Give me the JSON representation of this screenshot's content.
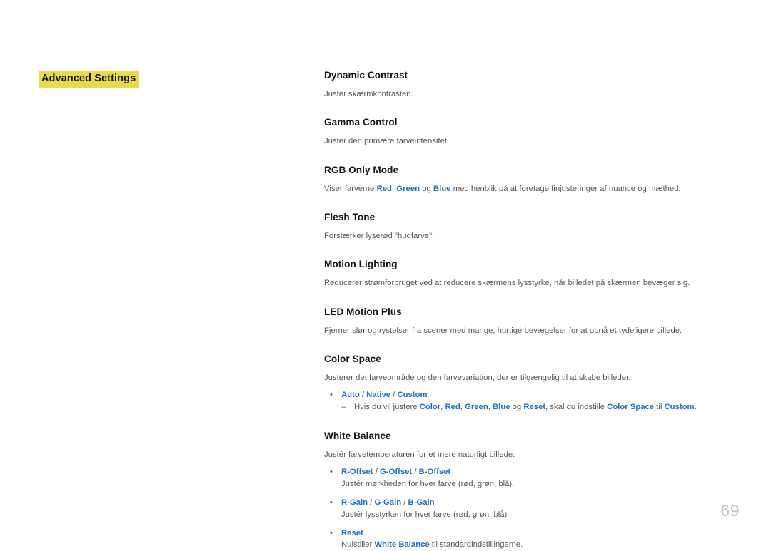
{
  "page": {
    "number": "69",
    "background": "#ffffff"
  },
  "colors": {
    "highlight": "#e9d94b",
    "accent_blue": "#1d6ec9",
    "body_text": "#58585a",
    "heading_text": "#141414",
    "page_number": "#c2c2c2"
  },
  "section": {
    "title": "Advanced Settings"
  },
  "entries": [
    {
      "title": "Dynamic Contrast",
      "desc": "Justér skærmkontrasten."
    },
    {
      "title": "Gamma Control",
      "desc": "Justér den primære farveintensitet."
    },
    {
      "title": "RGB Only Mode",
      "desc_parts": {
        "p1": "Viser farverne ",
        "b1": "Red",
        "p2": ", ",
        "b2": "Green",
        "p3": " og ",
        "b3": "Blue",
        "p4": " med henblik på at foretage finjusteringer af nuance og mæthed."
      }
    },
    {
      "title": "Flesh Tone",
      "desc": "Forstærker lyserød \"hudfarve\"."
    },
    {
      "title": "Motion Lighting",
      "desc": "Reducerer strømforbruget ved at reducere skærmens lysstyrke, når billedet på skærmen bevæger sig."
    },
    {
      "title": "LED Motion Plus",
      "desc": "Fjerner slør og rystelser fra scener med mange, hurtige bevægelser for at opnå et tydeligere billede."
    },
    {
      "title": "Color Space",
      "desc": "Justerer det farveområde og den farvevariation, der er tilgængelig til at skabe billeder.",
      "bullet": {
        "marker": "bullet-dot",
        "opt1": "Auto",
        "sep1": " / ",
        "opt2": "Native",
        "sep2": " / ",
        "opt3": "Custom",
        "sub": {
          "marker": "dash",
          "t1": "Hvis du vil justere ",
          "b1": "Color",
          "t2": ", ",
          "b2": "Red",
          "t3": ", ",
          "b3": "Green",
          "t4": ", ",
          "b4": "Blue",
          "t5": " og ",
          "b5": "Reset",
          "t6": ", skal du indstille ",
          "b6": "Color Space",
          "t7": " til ",
          "b7": "Custom",
          "t8": "."
        }
      }
    },
    {
      "title": "White Balance",
      "desc": "Justér farvetemperaturen for et mere naturligt billede.",
      "bullets": [
        {
          "marker": "bullet-dot",
          "opt1": "R-Offset",
          "sep1": " / ",
          "opt2": "G-Offset",
          "sep2": " / ",
          "opt3": "B-Offset",
          "sub": "Justér mørkheden for hver farve (rød, grøn, blå)."
        },
        {
          "marker": "bullet-dot",
          "opt1": "R-Gain",
          "sep1": " / ",
          "opt2": "G-Gain",
          "sep2": " / ",
          "opt3": "B-Gain",
          "sub": "Justér lysstyrken for hver farve (rød, grøn, blå)."
        },
        {
          "marker": "bullet-dot",
          "opt1": "Reset",
          "sub_parts": {
            "t1": "Nulstiller ",
            "b1": "White Balance",
            "t2": " til standardindstillingerne."
          }
        }
      ]
    }
  ],
  "icons": {
    "bullet_dot": "•",
    "dash": "–"
  }
}
